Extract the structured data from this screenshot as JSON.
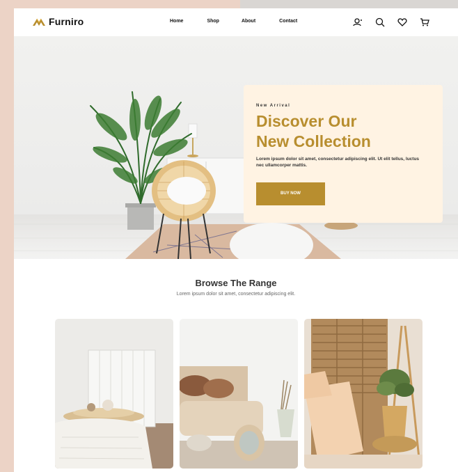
{
  "brand": {
    "name": "Furniro",
    "accent": "#b88e2f"
  },
  "nav": {
    "items": [
      "Home",
      "Shop",
      "About",
      "Contact"
    ]
  },
  "header_icons": [
    "user-icon",
    "search-icon",
    "heart-icon",
    "cart-icon"
  ],
  "hero": {
    "kicker": "New Arrival",
    "title_line1": "Discover Our",
    "title_line2": "New Collection",
    "description": "Lorem ipsum dolor sit amet, consectetur adipiscing elit. Ut elit tellus, luctus nec ullamcorper mattis.",
    "button_label": "BUY NOW"
  },
  "range": {
    "title": "Browse The Range",
    "subtitle": "Lorem ipsum dolor sit amet, consectetur adipiscing elit."
  }
}
